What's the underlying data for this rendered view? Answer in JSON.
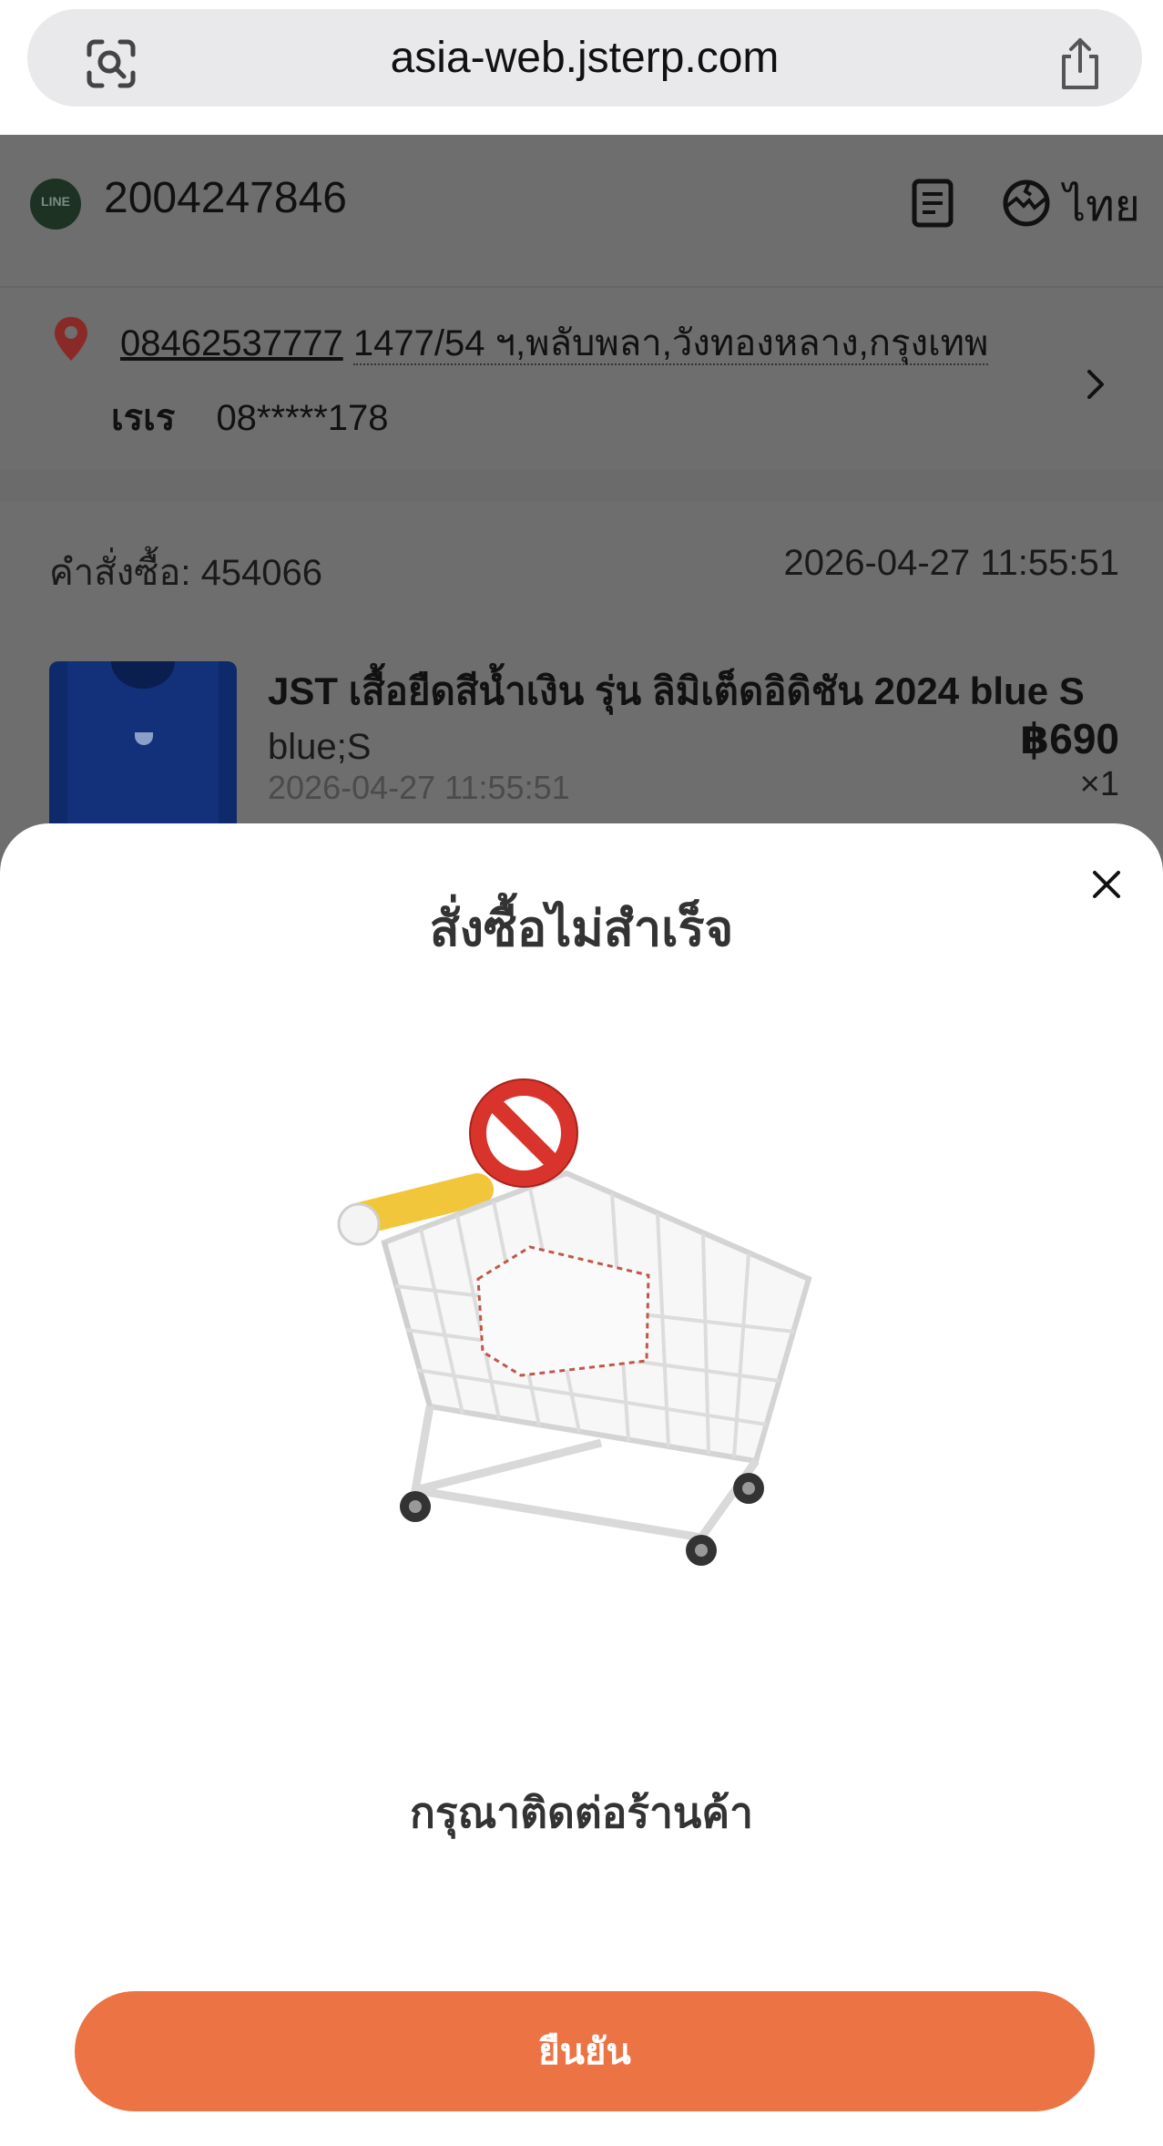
{
  "browser": {
    "url": "asia-web.jsterp.com",
    "lens_icon": "visual-lookup-icon",
    "share_icon": "share-icon"
  },
  "store": {
    "id": "2004247846",
    "language": "ไทย",
    "logo_text": "LINE"
  },
  "address": {
    "phone": "08462537777",
    "street": "1477/54 ฯ,พลับพลา,วังทองหลาง,กรุงเทพ",
    "recipient_name": "เรเร",
    "recipient_phone": "08*****178"
  },
  "order": {
    "number_label": "คำสั่งซื้อ: 454066",
    "time": "2026-04-27 11:55:51",
    "product": {
      "name": "JST เสื้อยืดสีน้ำเงิน รุ่น ลิมิเต็ดอิดิชัน 2024 blue S",
      "price": "฿690",
      "variant": "blue;S",
      "time": "2026-04-27 11:55:51",
      "quantity": "×1"
    }
  },
  "modal": {
    "title": "สั่งซื้อไม่สำเร็จ",
    "message": "กรุณาติดต่อร้านค้า",
    "confirm_label": "ยืนยัน",
    "illustration": "shopping-cart-prohibited",
    "accent_color": "#ec7444"
  }
}
